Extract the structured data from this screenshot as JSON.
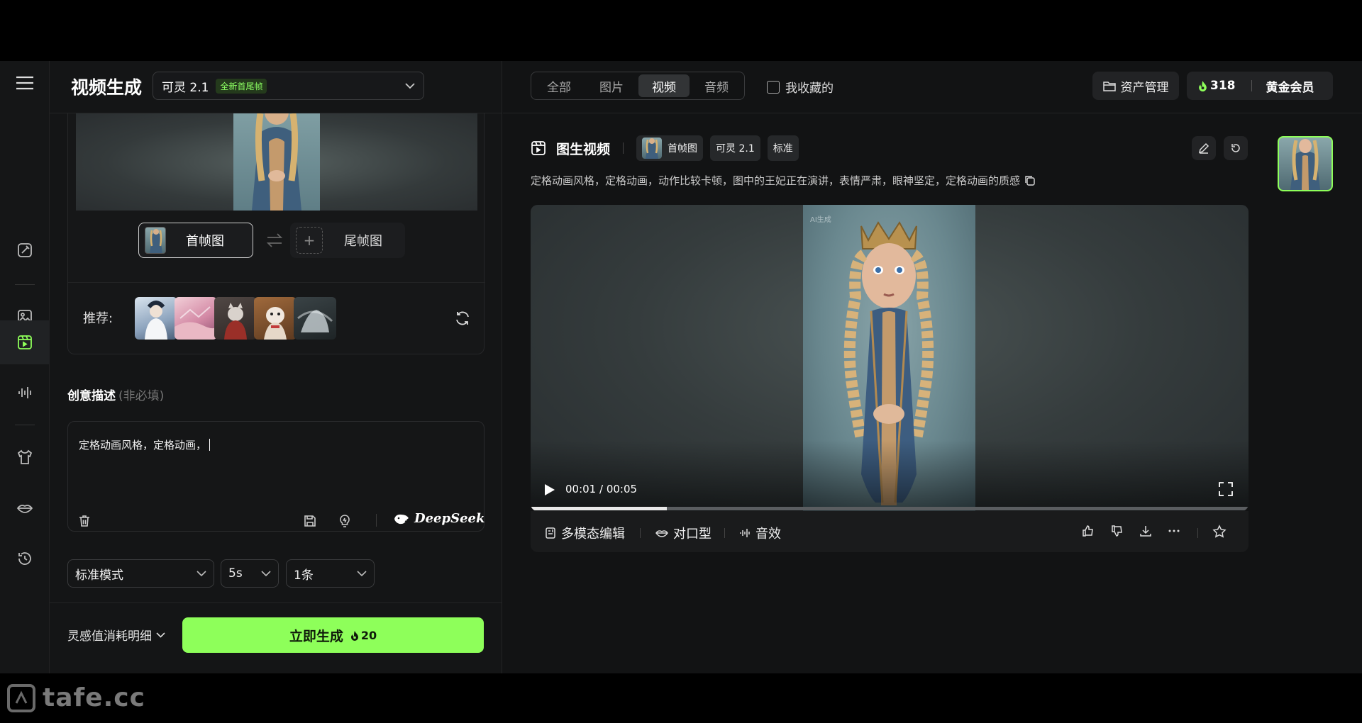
{
  "header": {
    "title": "视频生成",
    "model_name": "可灵 2.1",
    "model_tag": "全新首尾帧"
  },
  "frames": {
    "first_label": "首帧图",
    "last_label": "尾帧图"
  },
  "recommend": {
    "label": "推荐:"
  },
  "description": {
    "label": "创意描述",
    "optional": "(非必填)",
    "value": "定格动画风格，定格动画，",
    "deepseek_label": "DeepSeek"
  },
  "options": {
    "mode": "标准模式",
    "duration": "5s",
    "count": "1条"
  },
  "footer": {
    "cost_detail": "灵感值消耗明细",
    "generate_label": "立即生成",
    "generate_cost": "20"
  },
  "filters": {
    "tabs": [
      "全部",
      "图片",
      "视频",
      "音频"
    ],
    "active": "视频",
    "favorites_label": "我收藏的"
  },
  "account": {
    "asset_label": "资产管理",
    "credits": "318",
    "membership": "黄金会员"
  },
  "result": {
    "title": "图生视频",
    "chip_first_frame": "首帧图",
    "chip_model": "可灵 2.1",
    "chip_mode": "标准",
    "prompt": "定格动画风格，定格动画，动作比较卡顿，图中的王妃正在演讲，表情严肃，眼神坚定，定格动画的质感",
    "ai_tag": "AI生成",
    "time": "00:01 / 00:05",
    "progress": 0.19
  },
  "player_actions": {
    "multimodal_edit": "多模态编辑",
    "lip_sync": "对口型",
    "sound_effect": "音效"
  },
  "watermark": "tafe.cc",
  "colors": {
    "accent": "#8eff5a",
    "background": "#121314"
  }
}
